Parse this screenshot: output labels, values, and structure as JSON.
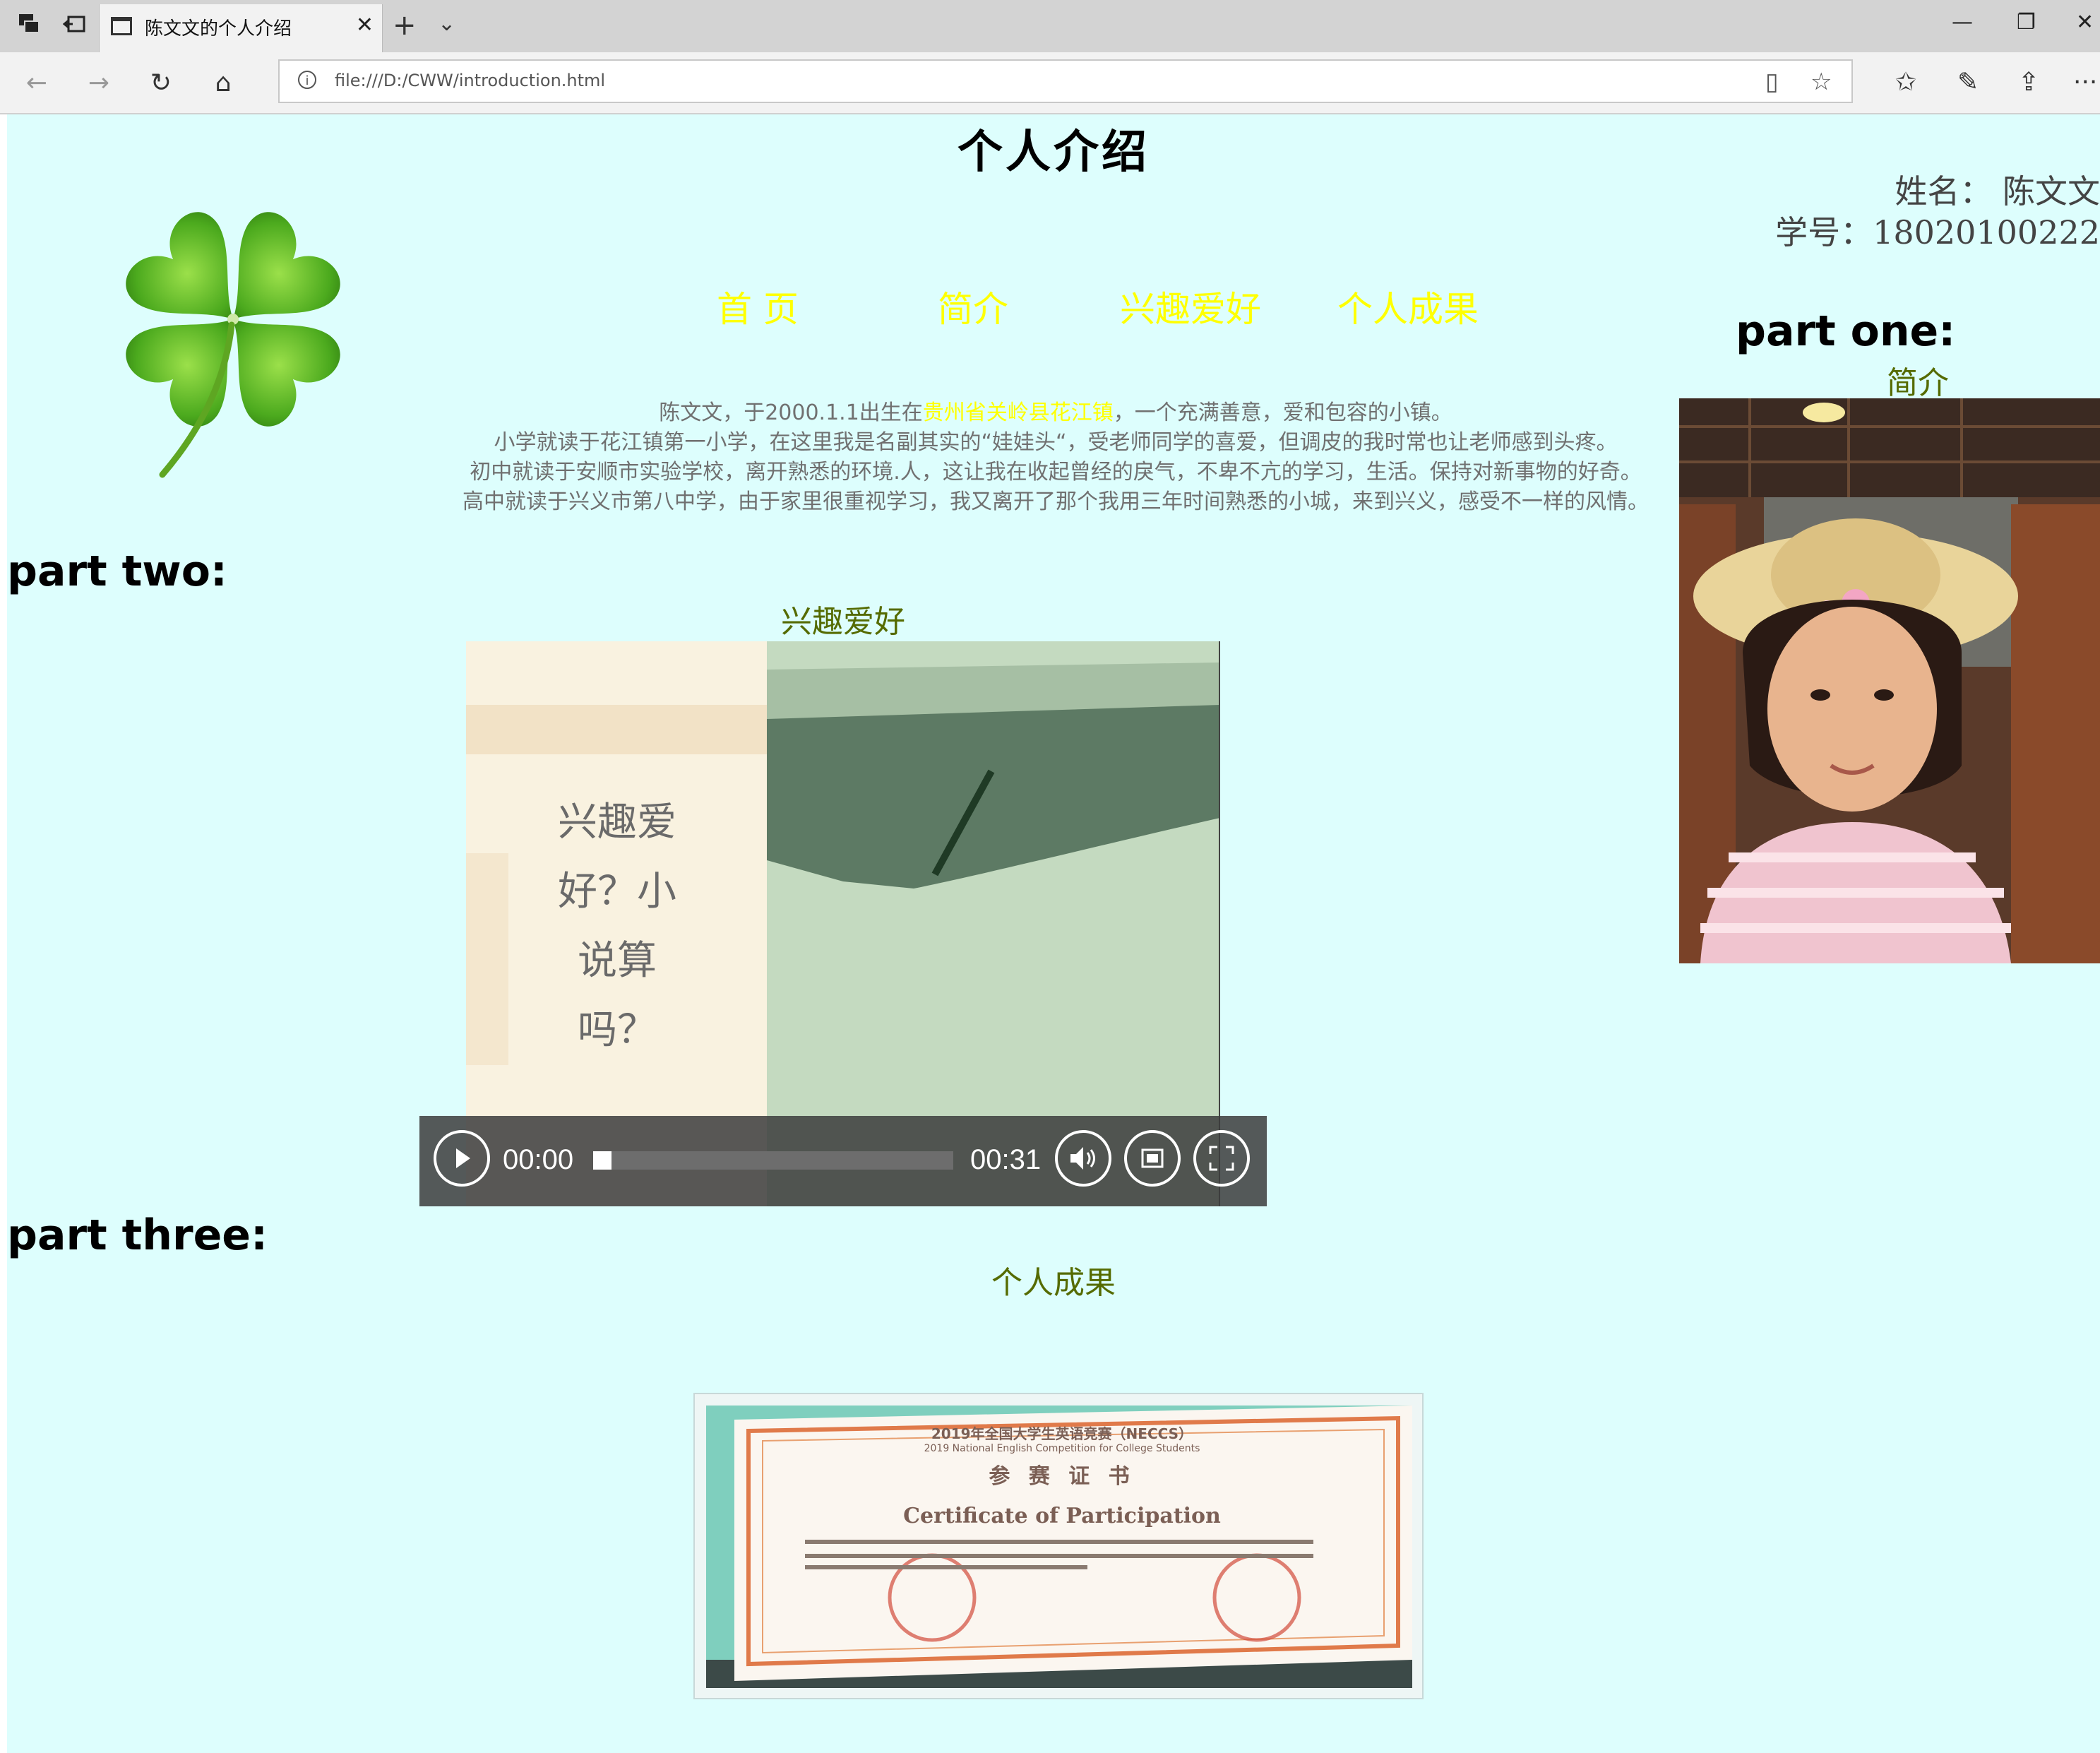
{
  "browser": {
    "tab_title": "陈文文的个人介绍",
    "address": "file:///D:/CWW/introduction.html",
    "tab_close": "✕",
    "new_tab": "+",
    "tab_menu": "⌄",
    "window_minimize": "—",
    "window_restore": "❐",
    "window_close": "✕",
    "more": "···"
  },
  "page": {
    "heading": "个人介绍",
    "name_line": "姓名：  陈文文",
    "student_id_line": "学号：18020100222",
    "nav": [
      "首 页",
      "简介",
      "兴趣爱好",
      "个人成果"
    ],
    "part_one": {
      "title": "part one:",
      "subtitle": "简介"
    },
    "intro": {
      "line1_pre": "陈文文，于2000.1.1出生在",
      "line1_highlight": "贵州省关岭县花江镇",
      "line1_post": "，一个充满善意，爱和包容的小镇。",
      "line2": "小学就读于花江镇第一小学，在这里我是名副其实的“娃娃头“，受老师同学的喜爱，但调皮的我时常也让老师感到头疼。",
      "line3": "初中就读于安顺市实验学校，离开熟悉的环境.人，这让我在收起曾经的戾气，不卑不亢的学习，生活。保持对新事物的好奇。",
      "line4": "高中就读于兴义市第八中学，由于家里很重视学习，我又离开了那个我用三年时间熟悉的小城，来到兴义，感受不一样的风情。"
    },
    "part_two": {
      "title": "part two:",
      "subtitle": "兴趣爱好",
      "video_text": [
        "兴趣爱",
        "好？小",
        "说算",
        "吗？"
      ],
      "time_current": "00:00",
      "time_total": "00:31",
      "progress": 0.0
    },
    "part_three": {
      "title": "part three:",
      "subtitle": "个人成果",
      "certificate_lines": [
        "2019年全国大学生英语竞赛（NECCS）",
        "2019 National English Competition for College Students",
        "参 赛 证 书",
        "Certificate of Participation"
      ]
    }
  },
  "colors": {
    "page_bg": "#ddfefd",
    "nav_link": "#ffff00",
    "subtitle": "#556b00",
    "intro_text": "#707070"
  }
}
